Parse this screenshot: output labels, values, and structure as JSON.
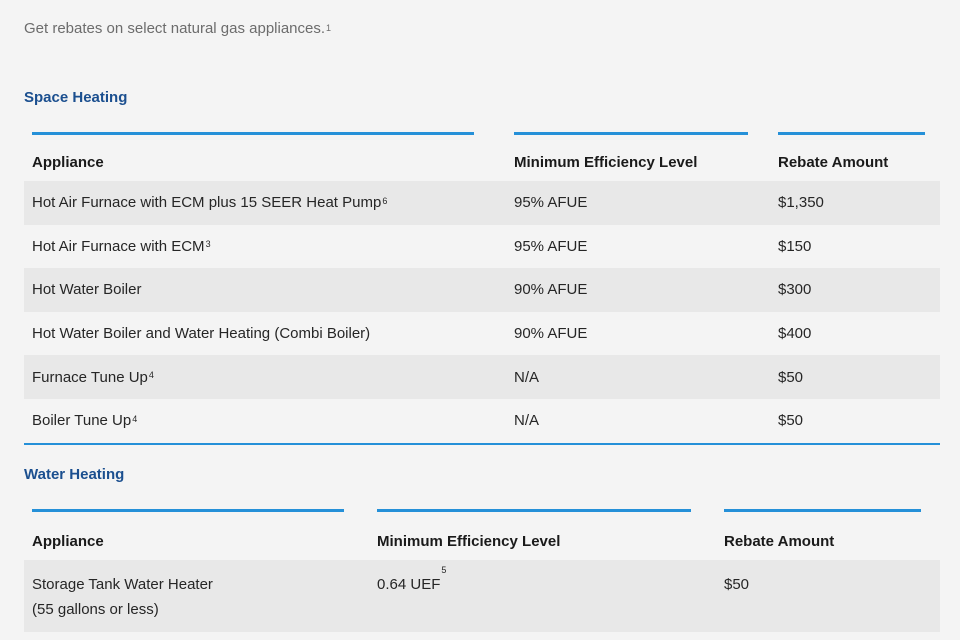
{
  "intro": {
    "text": "Get rebates on select natural gas appliances.",
    "sup": "1"
  },
  "space_heating": {
    "title": "Space Heating",
    "headers": [
      "Appliance",
      "Minimum Efficiency Level",
      "Rebate Amount"
    ],
    "rows": [
      {
        "appliance": "Hot Air Furnace with ECM plus 15 SEER Heat Pump",
        "sup": "6",
        "efficiency": "95% AFUE",
        "efficiency_sup": "",
        "rebate": "$1,350"
      },
      {
        "appliance": "Hot Air Furnace with ECM",
        "sup": "3",
        "efficiency": "95% AFUE",
        "efficiency_sup": "",
        "rebate": "$150"
      },
      {
        "appliance": "Hot Water Boiler",
        "sup": "",
        "efficiency": "90% AFUE",
        "efficiency_sup": "",
        "rebate": "$300"
      },
      {
        "appliance": "Hot Water Boiler and Water Heating (Combi Boiler)",
        "sup": "",
        "efficiency": "90% AFUE",
        "efficiency_sup": "",
        "rebate": "$400"
      },
      {
        "appliance": "Furnace Tune Up",
        "sup": "4",
        "efficiency": "N/A",
        "efficiency_sup": "",
        "rebate": "$50"
      },
      {
        "appliance": "Boiler Tune Up",
        "sup": "4",
        "efficiency": "N/A",
        "efficiency_sup": "",
        "rebate": "$50"
      }
    ]
  },
  "water_heating": {
    "title": "Water Heating",
    "headers": [
      "Appliance",
      "Minimum Efficiency Level",
      "Rebate Amount"
    ],
    "rows": [
      {
        "appliance": "Storage Tank Water Heater",
        "appliance_line2": "(55 gallons or less)",
        "sup": "",
        "efficiency": "0.64 UEF",
        "efficiency_sup": "5",
        "rebate": "$50"
      }
    ]
  },
  "colors": {
    "accent": "#2590d8",
    "title": "#1b4f8f",
    "row_shade": "#e8e8e8",
    "background": "#f4f4f4"
  }
}
